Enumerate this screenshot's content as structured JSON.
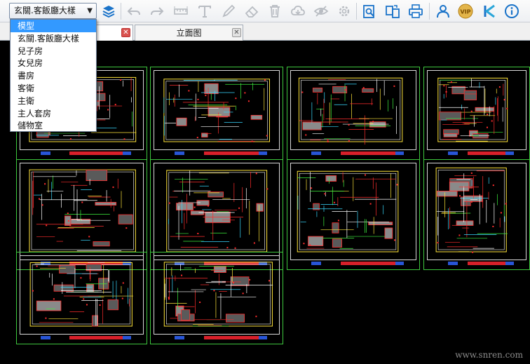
{
  "toolbar": {
    "layout_select_value": "玄關.客飯廳大樣",
    "icons": [
      "layers-icon",
      "undo-icon",
      "redo-icon",
      "measure-icon",
      "text-icon",
      "pen-icon",
      "eraser-icon",
      "delete-icon",
      "cloud-icon",
      "hide-icon",
      "settings-icon",
      "search-doc-icon",
      "convert-icon",
      "print-icon",
      "user-icon",
      "vip-icon",
      "logo-icon",
      "info-icon"
    ],
    "vip_label": "VIP"
  },
  "dropdown": {
    "items": [
      "模型",
      "玄關.客飯廳大樣",
      "兒子房",
      "女兒房",
      "書房",
      "客衛",
      "主衛",
      "主人套房",
      "儲物室"
    ],
    "selected_index": 0
  },
  "tabs": [
    {
      "label": ""
    },
    {
      "label": "立面图"
    }
  ],
  "canvas": {
    "background": "#000000",
    "sheet_border_color": "#3ec83e",
    "sheet_count": 11
  },
  "watermark": "www.snren.com"
}
